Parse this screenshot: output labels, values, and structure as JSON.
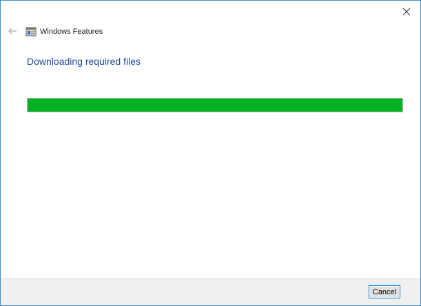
{
  "window": {
    "title": "Windows Features"
  },
  "main": {
    "heading": "Downloading required files",
    "progress_fraction": 1.0
  },
  "footer": {
    "cancel_label": "Cancel"
  },
  "icons": {
    "back": "back-arrow-icon",
    "close": "close-icon",
    "app": "windows-features-icon"
  },
  "colors": {
    "heading": "#1f4aa3",
    "progress_fill": "#06b025",
    "window_border": "#3c8fd0"
  }
}
